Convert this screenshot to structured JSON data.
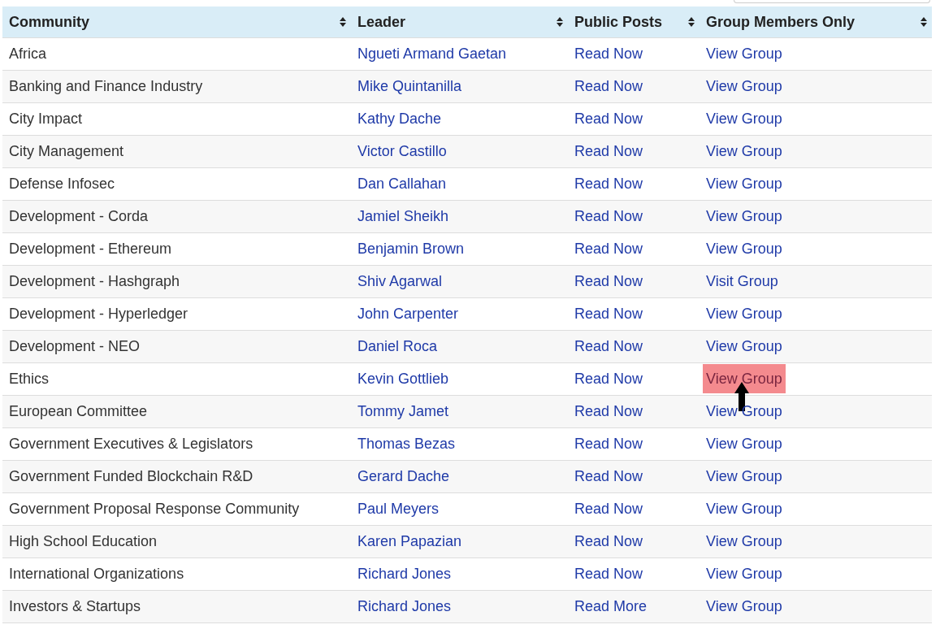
{
  "table": {
    "columns": [
      {
        "label": "Community"
      },
      {
        "label": "Leader"
      },
      {
        "label": "Public Posts"
      },
      {
        "label": "Group Members Only"
      }
    ],
    "rows": [
      {
        "community": "Africa",
        "leader": "Ngueti Armand Gaetan",
        "public_posts": "Read Now",
        "group": "View Group",
        "highlighted": false
      },
      {
        "community": "Banking and Finance Industry",
        "leader": "Mike Quintanilla",
        "public_posts": "Read Now",
        "group": "View Group",
        "highlighted": false
      },
      {
        "community": "City Impact",
        "leader": "Kathy Dache",
        "public_posts": "Read Now",
        "group": "View Group",
        "highlighted": false
      },
      {
        "community": "City Management",
        "leader": "Victor Castillo",
        "public_posts": "Read Now",
        "group": "View Group",
        "highlighted": false
      },
      {
        "community": "Defense Infosec",
        "leader": "Dan Callahan",
        "public_posts": "Read Now",
        "group": "View Group",
        "highlighted": false
      },
      {
        "community": "Development - Corda",
        "leader": "Jamiel Sheikh",
        "public_posts": "Read Now",
        "group": "View Group",
        "highlighted": false
      },
      {
        "community": "Development - Ethereum",
        "leader": "Benjamin Brown",
        "public_posts": "Read Now",
        "group": "View Group",
        "highlighted": false
      },
      {
        "community": "Development - Hashgraph",
        "leader": "Shiv Agarwal",
        "public_posts": "Read Now",
        "group": "Visit Group",
        "highlighted": false
      },
      {
        "community": "Development - Hyperledger",
        "leader": "John Carpenter",
        "public_posts": "Read Now",
        "group": "View Group",
        "highlighted": false
      },
      {
        "community": "Development - NEO",
        "leader": "Daniel Roca",
        "public_posts": "Read Now",
        "group": "View Group",
        "highlighted": false
      },
      {
        "community": "Ethics",
        "leader": "Kevin Gottlieb",
        "public_posts": "Read Now",
        "group": "View Group",
        "highlighted": true
      },
      {
        "community": "European Committee",
        "leader": "Tommy Jamet",
        "public_posts": "Read Now",
        "group": "View Group",
        "highlighted": false
      },
      {
        "community": "Government Executives & Legislators",
        "leader": "Thomas Bezas",
        "public_posts": "Read Now",
        "group": "View Group",
        "highlighted": false
      },
      {
        "community": "Government Funded Blockchain R&D",
        "leader": "Gerard Dache",
        "public_posts": "Read Now",
        "group": "View Group",
        "highlighted": false
      },
      {
        "community": "Government Proposal Response Community",
        "leader": "Paul Meyers",
        "public_posts": "Read Now",
        "group": "View Group",
        "highlighted": false
      },
      {
        "community": "High School Education",
        "leader": "Karen Papazian",
        "public_posts": "Read Now",
        "group": "View Group",
        "highlighted": false
      },
      {
        "community": "International Organizations",
        "leader": "Richard Jones",
        "public_posts": "Read Now",
        "group": "View Group",
        "highlighted": false
      },
      {
        "community": "Investors & Startups",
        "leader": "Richard Jones",
        "public_posts": "Read More",
        "group": "View Group",
        "highlighted": false
      }
    ]
  }
}
